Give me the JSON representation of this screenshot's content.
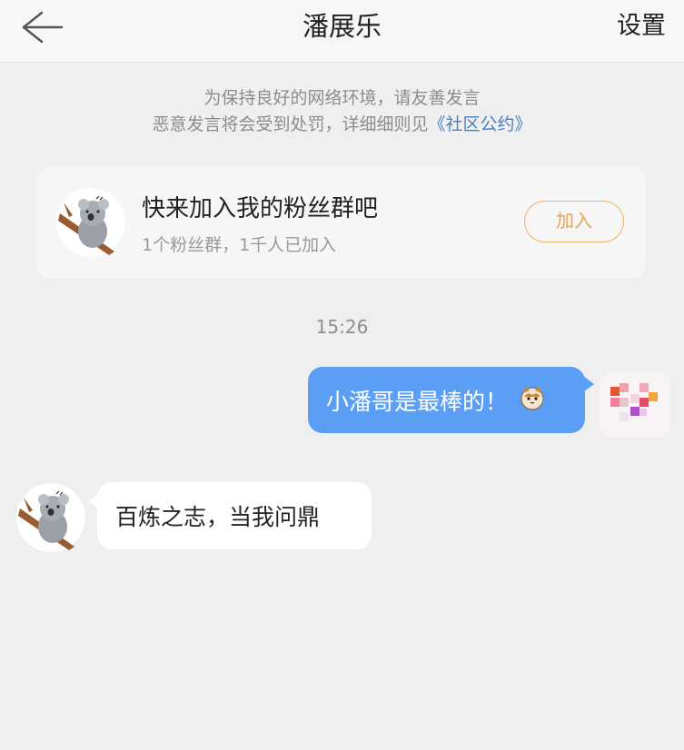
{
  "header": {
    "title": "潘展乐",
    "settings_label": "设置",
    "back_icon": "arrow-left-icon"
  },
  "notice": {
    "line1": "为保持良好的网络环境，请友善发言",
    "line2_prefix": "恶意发言将会受到处罚，详细细则见",
    "link_text": "《社区公约》",
    "link_color": "#4c7fbf"
  },
  "fan_group_card": {
    "title": "快来加入我的粉丝群吧",
    "subtitle": "1个粉丝群，1千人已加入",
    "join_label": "加入",
    "join_color": "#e5a458",
    "avatar_icon": "koala-avatar-icon"
  },
  "chat": {
    "timestamp": "15:26",
    "messages": [
      {
        "direction": "outgoing",
        "text": "小潘哥是最棒的！",
        "emoji": "cat-face-icon",
        "bubble_color": "#5a9ff5"
      },
      {
        "direction": "incoming",
        "text": "百炼之志，当我问鼎",
        "bubble_color": "#ffffff"
      }
    ]
  }
}
